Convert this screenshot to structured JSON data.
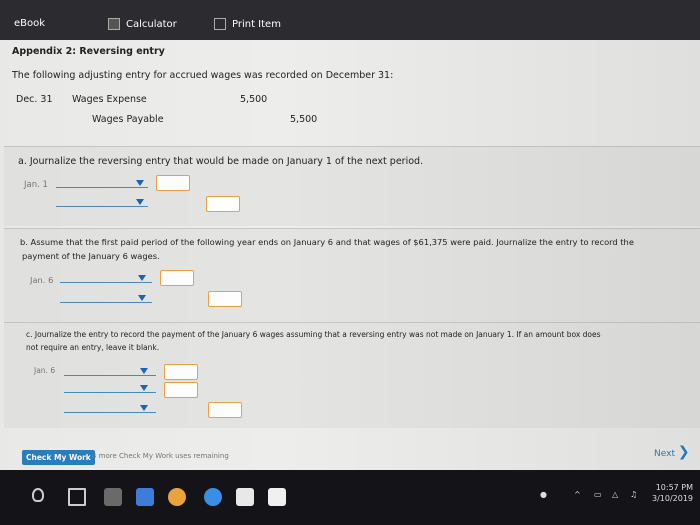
{
  "toolbar": {
    "ebook": "eBook",
    "calculator": "Calculator",
    "print": "Print Item"
  },
  "appendix_title": "Appendix 2: Reversing entry",
  "intro": "The following adjusting entry for accrued wages was recorded on December 31:",
  "adjusting_entry": {
    "date": "Dec. 31",
    "debit_account": "Wages Expense",
    "debit_amount": "5,500",
    "credit_account": "Wages Payable",
    "credit_amount": "5,500"
  },
  "part_a": {
    "prompt": "a. Journalize the reversing entry that would be made on January 1 of the next period.",
    "date": "Jan. 1"
  },
  "part_b": {
    "prompt_line1": "b. Assume that the first paid period of the following year ends on January 6 and that wages of $61,375 were paid. Journalize the entry to record the",
    "prompt_line2": "payment of the January 6 wages.",
    "date": "Jan. 6"
  },
  "part_c": {
    "prompt_line1": "c. Journalize the entry to record the payment of the January 6 wages assuming that a reversing entry was not made on January 1. If an amount box does",
    "prompt_line2": "not require an entry, leave it blank.",
    "date": "Jan. 6"
  },
  "footer": {
    "check_label": "Check My Work",
    "remaining": "4 more Check My Work uses remaining",
    "next_label": "Next"
  },
  "taskbar": {
    "time": "10:57 PM",
    "date": "3/10/2019"
  },
  "colors": {
    "accent": "#2a7fc0",
    "input_border": "#f0a040",
    "dropdown_arrow": "#1c63b7"
  }
}
